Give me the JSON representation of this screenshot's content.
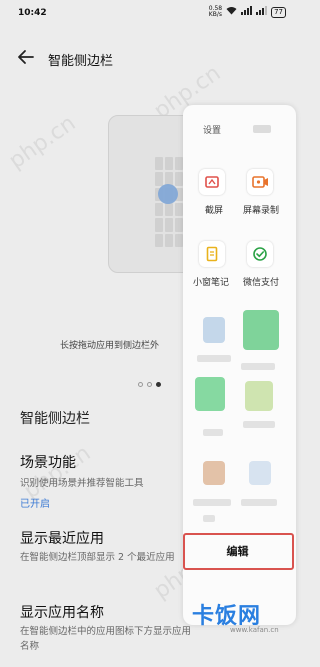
{
  "status_bar": {
    "time": "10:42",
    "net_speed_value": "0.58",
    "net_speed_unit": "KB/s",
    "battery": "77"
  },
  "header": {
    "back_icon": "arrow-left-icon",
    "title": "智能侧边栏"
  },
  "preview": {
    "caption": "长按拖动应用到侧边栏外",
    "pager_count": 3,
    "pager_active": 2
  },
  "section_title": "智能侧边栏",
  "settings": [
    {
      "title": "场景功能",
      "desc": "识别使用场景并推荐智能工具",
      "status": "已开启"
    },
    {
      "title": "显示最近应用",
      "desc": "在智能侧边栏顶部显示 2 个最近应用"
    },
    {
      "title": "显示应用名称",
      "desc": "在智能侧边栏中的应用图标下方显示应用名称"
    }
  ],
  "panel": {
    "settings_label": "设置",
    "tools": [
      {
        "label": "截屏",
        "icon": "screenshot-icon",
        "color": "#e0504a"
      },
      {
        "label": "屏幕录制",
        "icon": "screen-record-icon",
        "color": "#e8732c"
      },
      {
        "label": "小窗笔记",
        "icon": "note-icon",
        "color": "#e9b21c"
      },
      {
        "label": "微信支付",
        "icon": "wechat-pay-icon",
        "color": "#2ba246"
      }
    ],
    "edit_label": "编辑"
  },
  "watermark": "php.cn",
  "logo": {
    "mark": "卡饭网",
    "site": "www.kafan.cn"
  },
  "colors": {
    "background": "#ececec",
    "accent": "#3d7bd4",
    "highlight": "#d9534f"
  }
}
